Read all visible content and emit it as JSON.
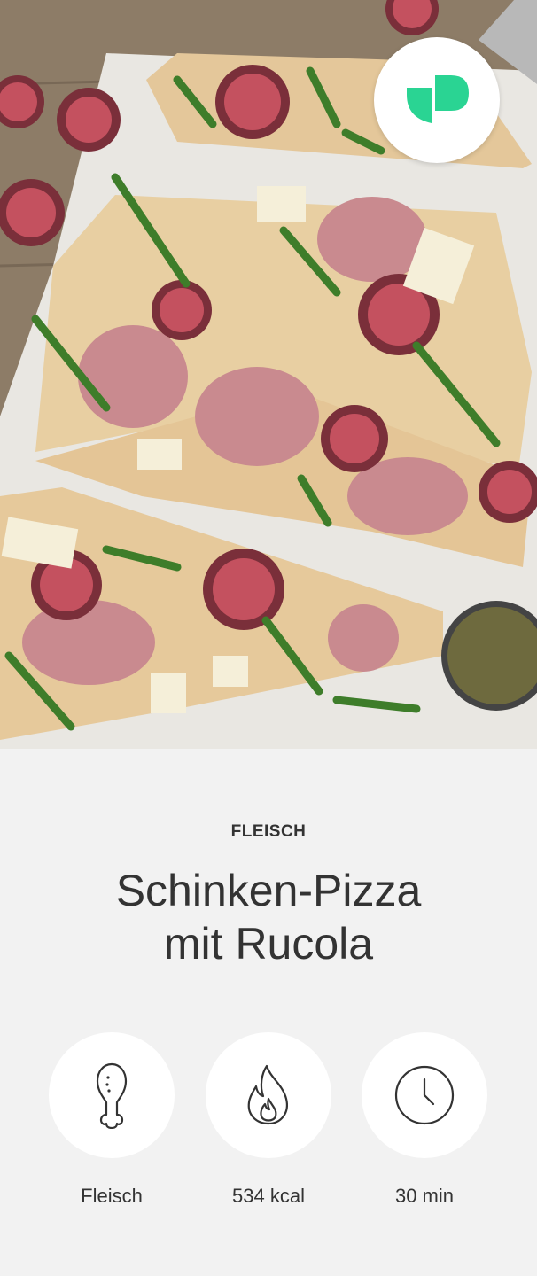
{
  "hero": {
    "image_alt": "Pizza mit Schinken, Rucola, Feigen und Parmesan auf Backpapier",
    "logo_icon": "app-logo-icon",
    "logo_color": "#2ad493"
  },
  "recipe": {
    "category": "FLEISCH",
    "title_line1": "Schinken-Pizza",
    "title_line2": "mit Rucola"
  },
  "stats": [
    {
      "icon": "chicken-leg-icon",
      "label": "Fleisch"
    },
    {
      "icon": "flame-icon",
      "label": "534 kcal"
    },
    {
      "icon": "clock-icon",
      "label": "30 min"
    }
  ]
}
